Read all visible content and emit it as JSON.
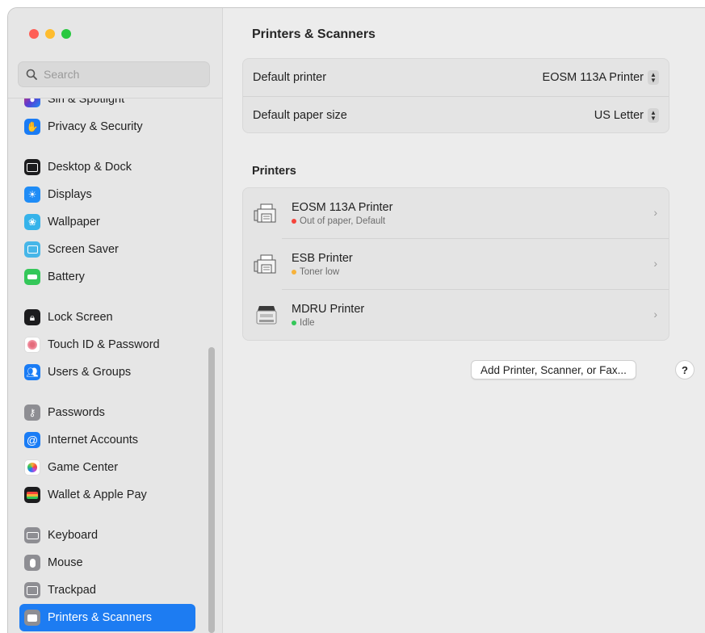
{
  "sidebar": {
    "search_placeholder": "Search",
    "items": [
      {
        "label": "Siri & Spotlight",
        "icon": "siri-icon",
        "color": "#5b3bd1"
      },
      {
        "label": "Privacy & Security",
        "icon": "hand-icon",
        "color": "#1a7cf5"
      },
      {
        "label": "Desktop & Dock",
        "icon": "dock-icon",
        "color": "#1c1c1e"
      },
      {
        "label": "Displays",
        "icon": "sun-icon",
        "color": "#1f8cf6"
      },
      {
        "label": "Wallpaper",
        "icon": "flower-icon",
        "color": "#36b3ea"
      },
      {
        "label": "Screen Saver",
        "icon": "screensaver-icon",
        "color": "#46b6e8"
      },
      {
        "label": "Battery",
        "icon": "battery-icon",
        "color": "#34c759"
      },
      {
        "label": "Lock Screen",
        "icon": "lock-icon",
        "color": "#1c1c1e"
      },
      {
        "label": "Touch ID & Password",
        "icon": "fingerprint-icon",
        "color": "#ffffff"
      },
      {
        "label": "Users & Groups",
        "icon": "users-icon",
        "color": "#1a7cf5"
      },
      {
        "label": "Passwords",
        "icon": "key-icon",
        "color": "#8e8e93"
      },
      {
        "label": "Internet Accounts",
        "icon": "at-icon",
        "color": "#1a7cf5"
      },
      {
        "label": "Game Center",
        "icon": "game-center-icon",
        "color": "#ffffff"
      },
      {
        "label": "Wallet & Apple Pay",
        "icon": "wallet-icon",
        "color": "#1c1c1e"
      },
      {
        "label": "Keyboard",
        "icon": "keyboard-icon",
        "color": "#8e8e93"
      },
      {
        "label": "Mouse",
        "icon": "mouse-icon",
        "color": "#8e8e93"
      },
      {
        "label": "Trackpad",
        "icon": "trackpad-icon",
        "color": "#8e8e93"
      },
      {
        "label": "Printers & Scanners",
        "icon": "printer-icon",
        "color": "#8e8e93"
      }
    ]
  },
  "main": {
    "title": "Printers & Scanners",
    "default_printer_label": "Default printer",
    "default_printer_value": "EOSM 113A Printer",
    "default_paper_label": "Default paper size",
    "default_paper_value": "US Letter",
    "printers_section": "Printers",
    "printers": [
      {
        "name": "EOSM 113A Printer",
        "status": "Out of paper, Default",
        "status_color": "#f5443b"
      },
      {
        "name": "ESB Printer",
        "status": "Toner low",
        "status_color": "#f7b23b"
      },
      {
        "name": "MDRU Printer",
        "status": "Idle",
        "status_color": "#34c759"
      }
    ],
    "add_button": "Add Printer, Scanner, or Fax...",
    "help_button": "?"
  },
  "colors": {
    "accent": "#1d7cf2"
  }
}
